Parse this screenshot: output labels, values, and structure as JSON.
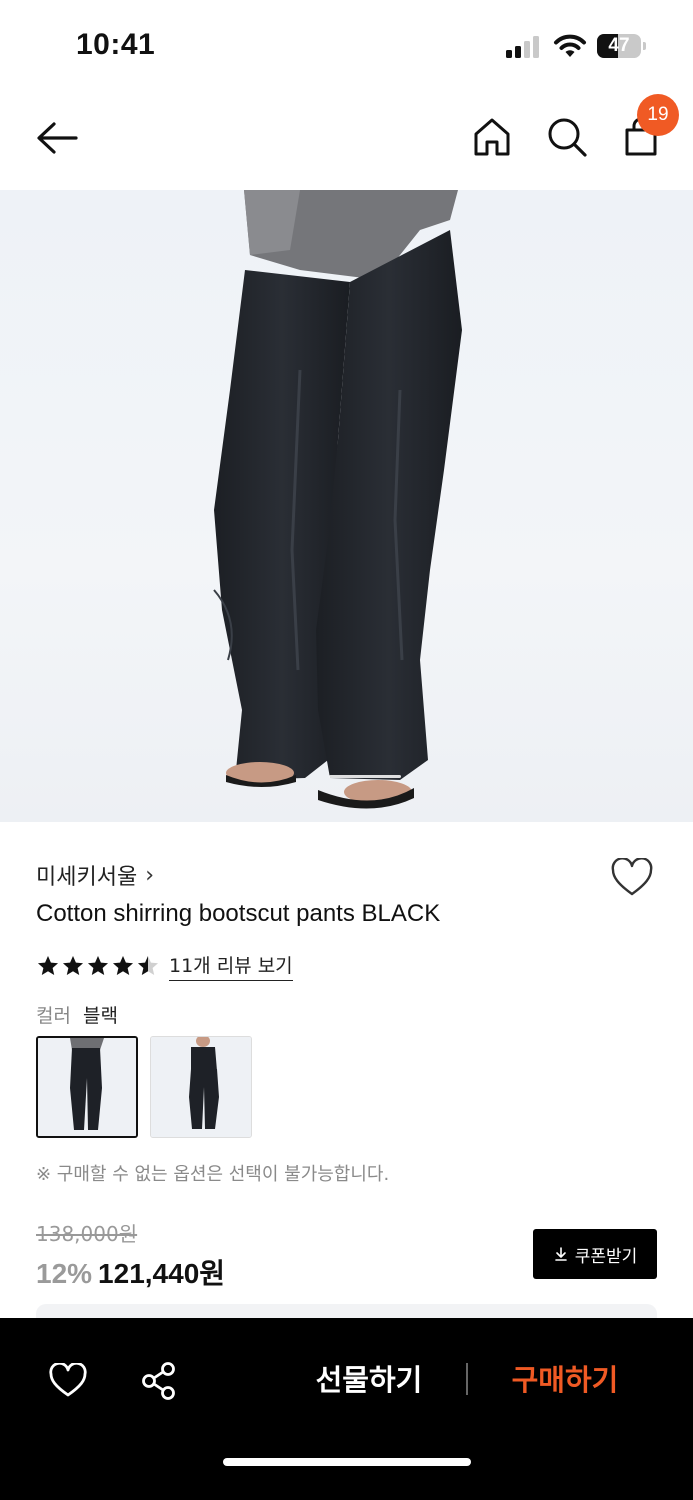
{
  "status_bar": {
    "time": "10:41",
    "battery": "47",
    "battery_level": 0.47,
    "icons": [
      "cellular-signal-icon",
      "wifi-icon",
      "battery-icon"
    ]
  },
  "nav": {
    "icons": [
      "back-arrow-icon",
      "home-icon",
      "search-icon",
      "shopping-bag-icon"
    ],
    "cart_count": "19",
    "badge_color": "#f05a24"
  },
  "hero": {
    "alt": "Model wearing black bootcut pants with sandals"
  },
  "product": {
    "brand": "미세키서울",
    "brand_chevron": "›",
    "title": "Cotton shirring bootscut pants BLACK",
    "rating": 4.5,
    "review_link": "11개 리뷰 보기",
    "color_label": "컬러",
    "color_value": "블랙",
    "option_note": "※ 구매할 수 없는 옵션은 선택이 불가능합니다.",
    "original_price": "138,000원",
    "discount": "12%",
    "price": "121,440원",
    "coupon_label": "쿠폰받기"
  },
  "bottom_bar": {
    "gift_label": "선물하기",
    "buy_label": "구매하기",
    "accent_color": "#f05a24"
  }
}
